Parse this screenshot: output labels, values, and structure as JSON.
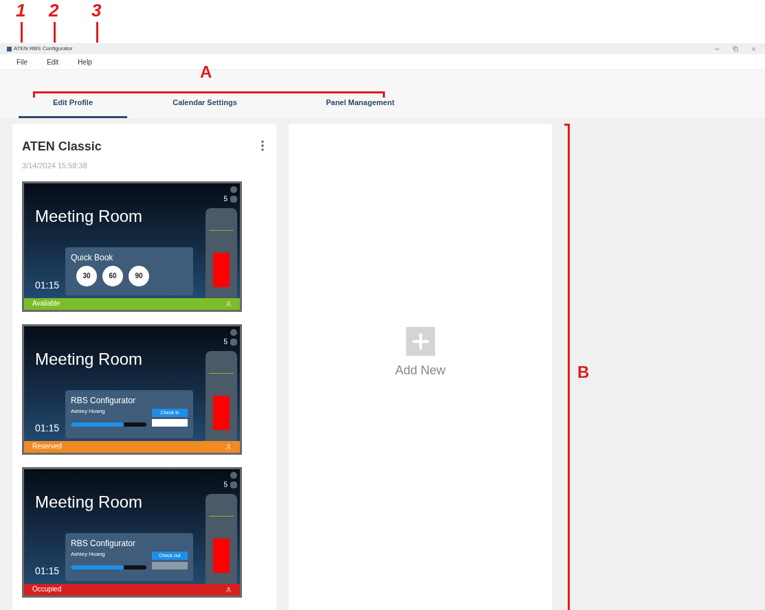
{
  "annotations": {
    "numbers": [
      "1",
      "2",
      "3"
    ],
    "letters": [
      "A",
      "B"
    ]
  },
  "window": {
    "title": "ATEN RBS Configurator"
  },
  "menu": [
    "File",
    "Edit",
    "Help"
  ],
  "tabs": [
    {
      "label": "Edit Profile",
      "selected": true
    },
    {
      "label": "Calendar Settings",
      "selected": false
    },
    {
      "label": "Panel Management",
      "selected": false
    }
  ],
  "profile": {
    "name": "ATEN Classic",
    "timestamp": "3/14/2024 15:58:38",
    "previews": [
      {
        "kind": "quick_book",
        "room": "Meeting Room",
        "time": "01:15",
        "count": "5",
        "panel_title": "Quick Book",
        "durations": [
          "30",
          "60",
          "90"
        ],
        "status": "Available",
        "color": "#7bbd2a"
      },
      {
        "kind": "booking",
        "room": "Meeting Room",
        "time": "01:15",
        "count": "5",
        "panel_title": "RBS Configurator",
        "organizer": "Ashley Huang",
        "level": 0.7,
        "action": "Check in",
        "status": "Reserved",
        "color": "#f08a24"
      },
      {
        "kind": "booking",
        "room": "Meeting Room",
        "time": "01:15",
        "count": "5",
        "panel_title": "RBS Configurator",
        "organizer": "Ashley Huang",
        "level": 0.7,
        "action": "Check out",
        "status": "Occupied",
        "color": "#d42020"
      }
    ]
  },
  "add_new": {
    "label": "Add New"
  }
}
